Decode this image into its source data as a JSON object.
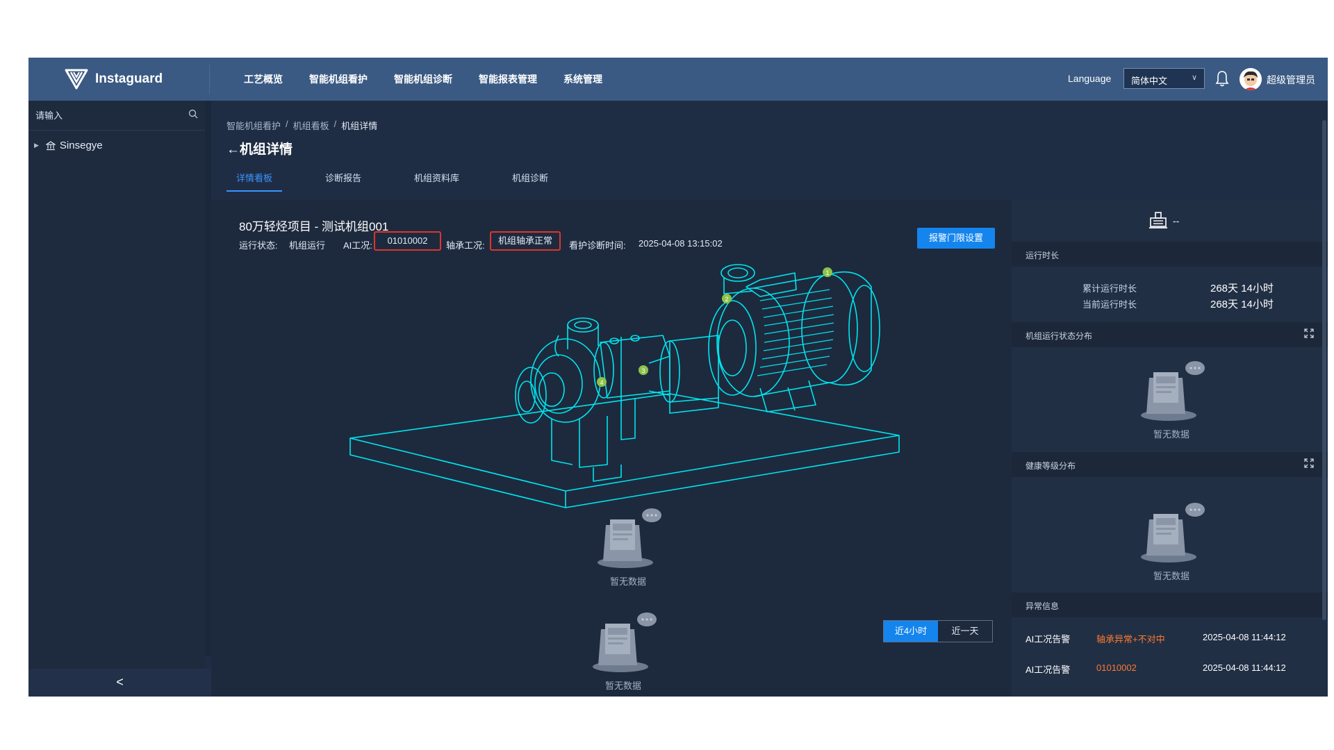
{
  "brand": {
    "name": "Instaguard"
  },
  "nav": {
    "items": [
      "工艺概览",
      "智能机组看护",
      "智能机组诊断",
      "智能报表管理",
      "系统管理"
    ],
    "language_label": "Language",
    "language_value": "简体中文",
    "user_name": "超级管理员"
  },
  "sidebar": {
    "search_placeholder": "请输入",
    "tree_root": "Sinsegye",
    "collapse": "<"
  },
  "breadcrumb": [
    "智能机组看护",
    "机组看板",
    "机组详情"
  ],
  "page_title": "←机组详情",
  "tabs": [
    "详情看板",
    "诊断报告",
    "机组资料库",
    "机组诊断"
  ],
  "unit": {
    "title": "80万轻烃项目 - 测试机组001",
    "status_label": "运行状态:",
    "status_value": "机组运行",
    "ai_label": "AI工况:",
    "ai_value": "01010002",
    "bearing_label": "轴承工况:",
    "bearing_value": "机组轴承正常",
    "diag_label": "看护诊断时间:",
    "diag_value": "2025-04-08 13:15:02",
    "alarm_button": "报警门限设置"
  },
  "pump_markers": [
    "1",
    "2",
    "3",
    "4"
  ],
  "empty_text": "暂无数据",
  "time_range": {
    "options": [
      "近4小时",
      "近一天"
    ],
    "selected": "近4小时"
  },
  "right": {
    "header_value": "--",
    "runtime": {
      "title": "运行时长",
      "total_label": "累计运行时长",
      "total_value": "268天 14小时",
      "current_label": "当前运行时长",
      "current_value": "268天 14小时"
    },
    "status_dist_title": "机组运行状态分布",
    "health_dist_title": "健康等级分布",
    "abnormal": {
      "title": "异常信息",
      "rows": [
        {
          "type": "AI工况告警",
          "detail": "轴承异常+不对中",
          "time": "2025-04-08 11:44:12"
        },
        {
          "type": "AI工况告警",
          "detail": "01010002",
          "time": "2025-04-08 11:44:12"
        }
      ]
    }
  },
  "colors": {
    "topbar": "#3a5a83",
    "accent": "#1585ee",
    "alert": "#e0332c",
    "warn_text": "#ff7a2e",
    "wireframe": "#00e5ee",
    "marker": "#8bc34a"
  }
}
